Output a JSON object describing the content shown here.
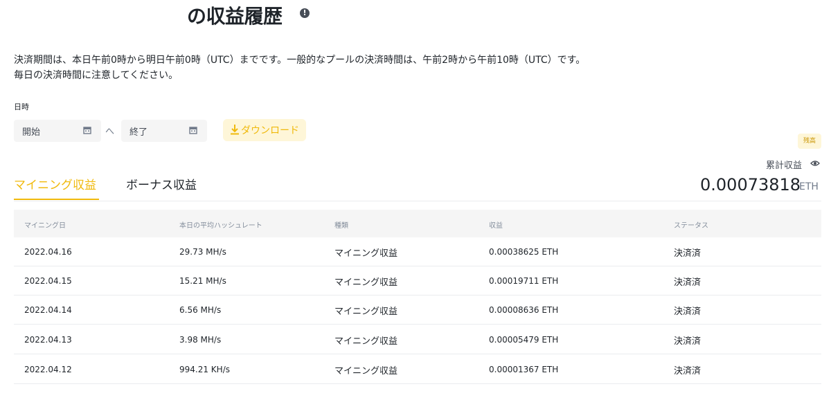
{
  "header": {
    "title": "の収益履歴",
    "info_icon": "info-icon"
  },
  "notice": {
    "line1": "決済期間は、本日午前0時から明日午前0時（UTC）までです。一般的なプールの決済時間は、午前2時から午前10時（UTC）です。",
    "line2": "毎日の決済時間に注意してください。"
  },
  "filters": {
    "date_label": "日時",
    "start_placeholder": "開始",
    "end_placeholder": "終了",
    "separator": "へ",
    "calendar_icon": "calendar-icon",
    "download_label": "ダウンロード",
    "download_icon": "download-icon"
  },
  "summary": {
    "balance_badge": "残高",
    "cumulative_label": "累計収益",
    "visibility_icon": "eye-icon",
    "cumulative_value": "0.00073818",
    "unit": "ETH"
  },
  "tabs": [
    {
      "label": "マイニング収益",
      "active": true
    },
    {
      "label": "ボーナス収益",
      "active": false
    }
  ],
  "table": {
    "columns": [
      "マイニング日",
      "本日の平均ハッシュレート",
      "種類",
      "収益",
      "ステータス"
    ],
    "rows": [
      {
        "date": "2022.04.16",
        "hashrate": "29.73 MH/s",
        "type": "マイニング収益",
        "earnings": "0.00038625 ETH",
        "status": "決済済"
      },
      {
        "date": "2022.04.15",
        "hashrate": "15.21 MH/s",
        "type": "マイニング収益",
        "earnings": "0.00019711 ETH",
        "status": "決済済"
      },
      {
        "date": "2022.04.14",
        "hashrate": "6.56 MH/s",
        "type": "マイニング収益",
        "earnings": "0.00008636 ETH",
        "status": "決済済"
      },
      {
        "date": "2022.04.13",
        "hashrate": "3.98 MH/s",
        "type": "マイニング収益",
        "earnings": "0.00005479 ETH",
        "status": "決済済"
      },
      {
        "date": "2022.04.12",
        "hashrate": "994.21 KH/s",
        "type": "マイニング収益",
        "earnings": "0.00001367 ETH",
        "status": "決済済"
      }
    ]
  },
  "colors": {
    "accent": "#f0b90b",
    "accent_bg": "#fef6d8",
    "text": "#1e2329",
    "muted": "#848e9c"
  }
}
